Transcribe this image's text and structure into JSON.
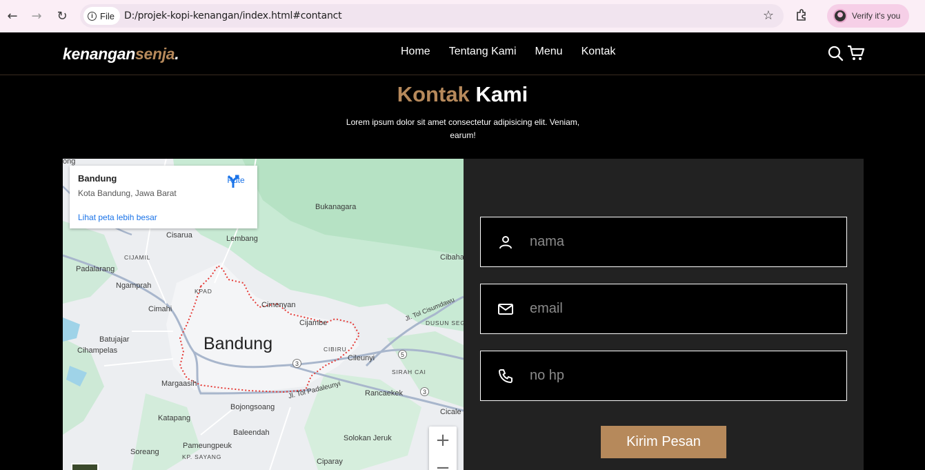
{
  "browser": {
    "file_label": "File",
    "url": "D:/projek-kopi-kenangan/index.html#contanct",
    "profile_label": "Verify it's you"
  },
  "header": {
    "logo_main": "kenangan",
    "logo_accent": "senja",
    "logo_dot": ".",
    "nav": [
      "Home",
      "Tentang Kami",
      "Menu",
      "Kontak"
    ]
  },
  "contact": {
    "title_accent": "Kontak",
    "title_main": "Kami",
    "subtitle": "Lorem ipsum dolor sit amet consectetur adipisicing elit. Veniam, earum!"
  },
  "map": {
    "place_title": "Bandung",
    "place_sub": "Kota Bandung, Jawa Barat",
    "route_label": "Rute",
    "bigger_map_link": "Lihat peta lebih besar",
    "city_label": "Bandung",
    "labels": {
      "bukanagara": "Bukanagara",
      "cisarua": "Cisarua",
      "lembang": "Lembang",
      "cijamil": "CIJAMIL",
      "padalarang": "Padalarang",
      "ngamprah": "Ngamprah",
      "cibaha": "Cibaha",
      "kpad": "KPAD",
      "cimenyan": "Cimenyan",
      "cimahi": "Cimahi",
      "cijambe": "Cijambe",
      "jl_cisumdawu": "Jl. Tol Cisumdawu",
      "dusun_sega": "DUSUN SEGA",
      "batujajar": "Batujajar",
      "cihampelas": "Cihampelas",
      "cibiru": "CIBIRU",
      "cileunyi": "Cileunyi",
      "margaasih": "Margaasih",
      "sirah_cai": "SIRAH CAI",
      "rancaekek": "Rancaekek",
      "jl_padaleunyi": "Jl. Tol Padaleunyi",
      "bojongsoang": "Bojongsoang",
      "katapang": "Katapang",
      "cicale": "Cicale",
      "baleendah": "Baleendah",
      "solokan_jeruk": "Solokan Jeruk",
      "pameungpeuk": "Pameungpeuk",
      "soreang": "Soreang",
      "kp_sayang": "KP. SAYANG",
      "ciparay": "Ciparay",
      "ong": "ong",
      "route3a": "3",
      "route5": "5",
      "route3b": "3"
    }
  },
  "form": {
    "name_placeholder": "nama",
    "email_placeholder": "email",
    "phone_placeholder": "no hp",
    "submit_label": "Kirim Pesan"
  }
}
